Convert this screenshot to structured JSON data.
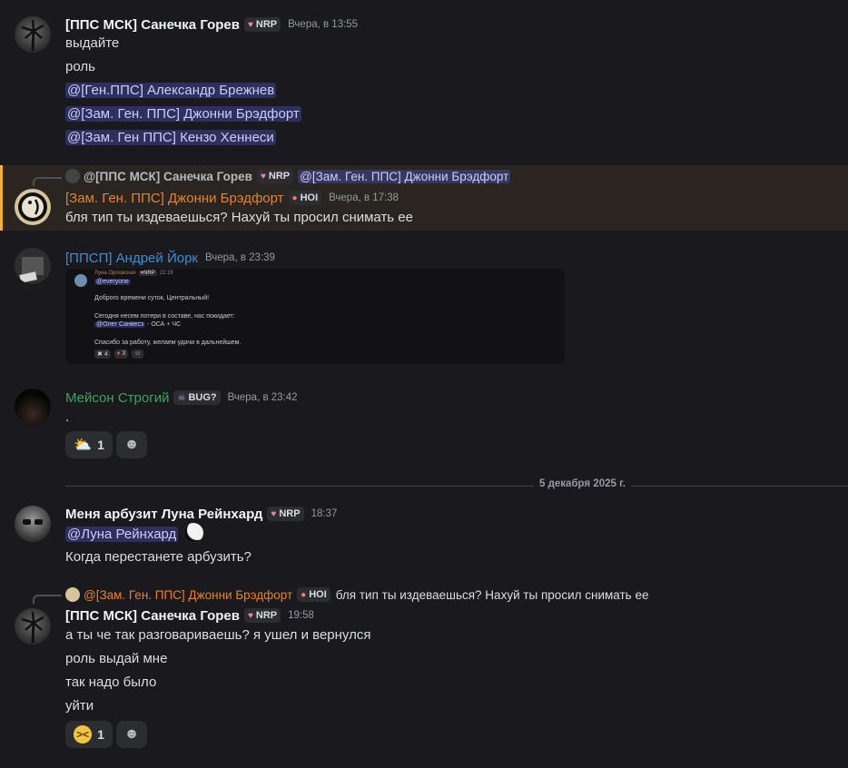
{
  "messages": [
    {
      "author": "[ППС МСК] Санечка Горев",
      "tag": "NRP",
      "timestamp": "Вчера, в 13:55",
      "lines": [
        "выдайте",
        "роль"
      ],
      "mentions": [
        "@[Ген.ППС] Александр Брежнев",
        "@[Зам. Ген. ППС] Джонни Брэдфорт",
        "@[Зам. Ген ППС] Кензо Хеннеси"
      ]
    },
    {
      "reply": {
        "author": "@[ППС МСК] Санечка Горев",
        "tag": "NRP",
        "mention": "@[Зам. Ген. ППС] Джонни Брэдфорт"
      },
      "author": "[Зам. Ген. ППС] Джонни Брэдфорт",
      "tag": "HOI",
      "timestamp": "Вчера, в 17:38",
      "text": "бля тип ты издеваешься? Нахуй ты просил снимать ее"
    },
    {
      "author": "[ППСП] Андрей Йорк",
      "timestamp": "Вчера, в 23:39",
      "embed": {
        "author": "Луна Орловская",
        "tag": "NRP",
        "time": "22:19",
        "mention": "@everyone",
        "line1": "Доброго времени суток, Центральный!",
        "line2": "Сегодня несем потери в составе, нас покидает:",
        "mention2": "@Олег Санвесз",
        "line2b": "- ОСА + ЧС",
        "line3": "Спасибо за работу, желаем удачи в дальнейшем.",
        "reaction1": "4",
        "reaction2": "3"
      }
    },
    {
      "author": "Мейсон Строгий",
      "tag": "BUG?",
      "timestamp": "Вчера, в 23:42",
      "text": ".",
      "reaction_count": "1"
    },
    {
      "divider": "5 декабря 2025 г."
    },
    {
      "author": "Меня арбузит Луна Рейнхард",
      "tag": "NRP",
      "timestamp": "18:37",
      "mention": "@Луна Рейнхард",
      "text": "Когда перестанете арбузить?"
    },
    {
      "reply": {
        "author": "@[Зам. Ген. ППС] Джонни Брэдфорт",
        "tag": "HOI",
        "text": "бля тип ты издеваешься? Нахуй ты просил снимать ее"
      },
      "author": "[ППС МСК] Санечка Горев",
      "tag": "NRP",
      "timestamp": "19:58",
      "lines": [
        "а ты че так разговариваешь? я ушел и вернулся",
        "роль выдай мне",
        "так надо было",
        "уйти"
      ],
      "reaction_count": "1"
    }
  ],
  "colors": {
    "orange": "#e8822a",
    "blue": "#3a8fd6",
    "green": "#3aa55c"
  }
}
